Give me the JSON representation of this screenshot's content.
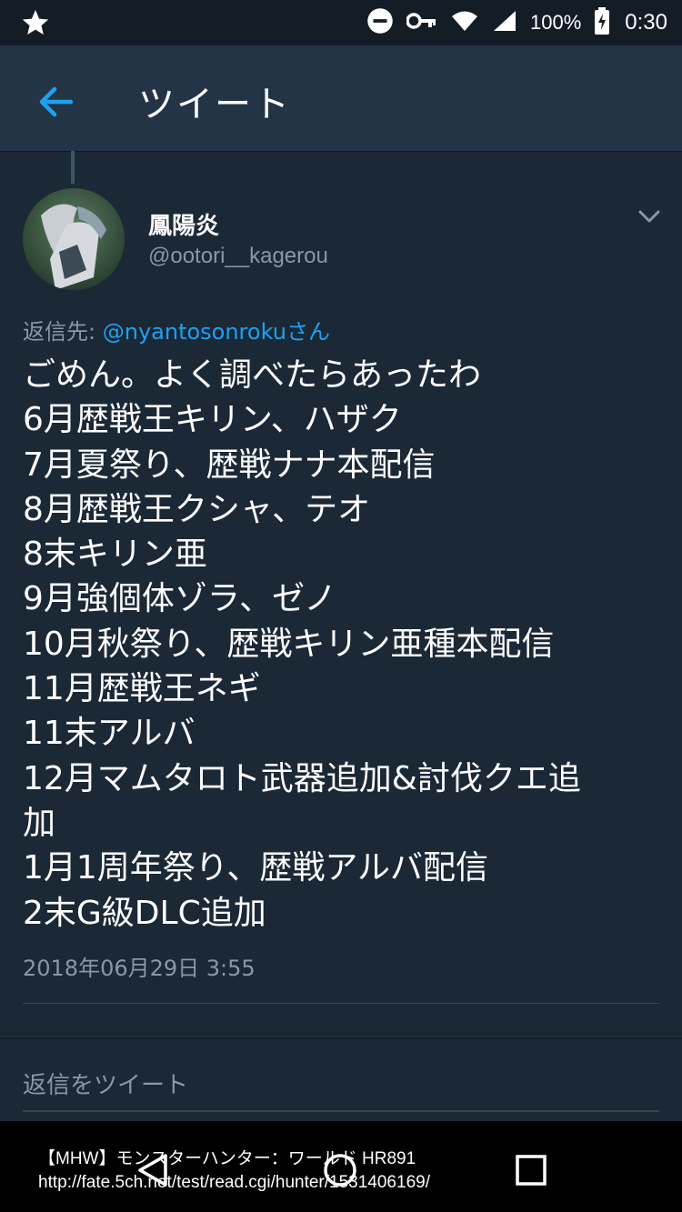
{
  "status_bar": {
    "battery_percent": "100%",
    "time": "0:30"
  },
  "app_bar": {
    "title": "ツイート"
  },
  "tweet": {
    "display_name": "鳳陽炎",
    "handle": "@ootori__kagerou",
    "reply_to_label": "返信先:",
    "reply_to_user": "@nyantosonroku",
    "reply_to_suffix": "さん",
    "lines": [
      "ごめん。よく調べたらあったわ",
      "6月歴戦王キリン、ハザク",
      "7月夏祭り、歴戦ナナ本配信",
      "8月歴戦王クシャ、テオ",
      "8末キリン亜",
      "9月強個体ゾラ、ゼノ",
      "10月秋祭り、歴戦キリン亜種本配信",
      "11月歴戦王ネギ",
      "11末アルバ",
      "12月マムタロト武器追加&討伐クエ追",
      "加",
      "1月1周年祭り、歴戦アルバ配信",
      "2末G級DLC追加"
    ],
    "timestamp": "2018年06月29日 3:55"
  },
  "reply_bar": {
    "placeholder": "返信をツイート"
  },
  "overlay_caption": {
    "line1": "【MHW】モンスターハンター：ワールド HR891",
    "line2": "http://fate.5ch.net/test/read.cgi/hunter/1531406169/"
  },
  "colors": {
    "background": "#1b2836",
    "app_bar": "#243447",
    "accent": "#1da1f2",
    "secondary_text": "#8899a6"
  }
}
